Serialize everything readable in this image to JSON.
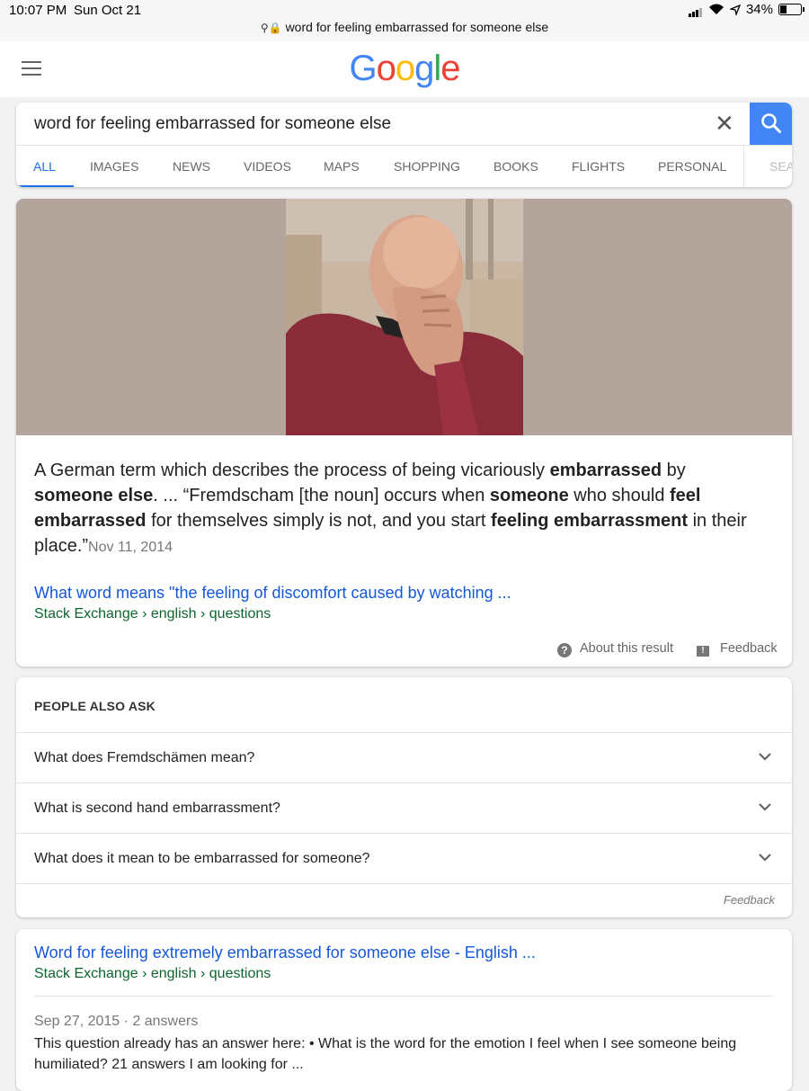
{
  "status_bar": {
    "time": "10:07 PM",
    "date": "Sun Oct 21",
    "url": "word for feeling embarrassed for someone else",
    "battery": "34%",
    "battery_level": 0.34
  },
  "header": {
    "logo_letters": [
      {
        "ch": "G",
        "color": "#4285f4"
      },
      {
        "ch": "o",
        "color": "#ea4335"
      },
      {
        "ch": "o",
        "color": "#fbbc05"
      },
      {
        "ch": "g",
        "color": "#4285f4"
      },
      {
        "ch": "l",
        "color": "#34a853"
      },
      {
        "ch": "e",
        "color": "#ea4335"
      }
    ]
  },
  "search": {
    "query": "word for feeling embarrassed for someone else",
    "clear": "✕"
  },
  "tabs": [
    {
      "label": "ALL",
      "active": true
    },
    {
      "label": "IMAGES"
    },
    {
      "label": "NEWS"
    },
    {
      "label": "VIDEOS"
    },
    {
      "label": "MAPS"
    },
    {
      "label": "SHOPPING"
    },
    {
      "label": "BOOKS"
    },
    {
      "label": "FLIGHTS"
    },
    {
      "label": "PERSONAL"
    },
    {
      "label": "SEA"
    }
  ],
  "featured": {
    "s1": "A German term which describes the process of being vicariously ",
    "b1": "embarrassed",
    "s2": " by ",
    "b2": "someone else",
    "s3": ". ... “Fremdscham [the noun] occurs when ",
    "b3": "someone",
    "s4": " who should ",
    "b4": "feel embarrassed",
    "s5": " for themselves simply is not, and you start ",
    "b5": "feeling embarrassment",
    "s6": " in their place.”",
    "date": "Nov 11, 2014",
    "link": "What word means \"the feeling of discomfort caused by watching ...",
    "breadcrumb": "Stack Exchange › english › questions",
    "about": "About this result",
    "feedback": "Feedback"
  },
  "people_also_ask": {
    "title": "PEOPLE ALSO ASK",
    "questions": [
      "What does Fremdschämen mean?",
      "What is second hand embarrassment?",
      "What does it mean to be embarrassed for someone?"
    ],
    "feedback": "Feedback"
  },
  "result": {
    "title": "Word for feeling extremely embarrassed for someone else - English ...",
    "breadcrumb": "Stack Exchange › english › questions",
    "meta": "Sep 27, 2015 · 2 answers",
    "description": "This question already has an answer here: • What is the word for the emotion I feel when I see someone being humiliated? 21 answers I am looking for ..."
  },
  "colors": {
    "link": "#1558d6",
    "url_green": "#0d652d",
    "accent_blue": "#4285f4",
    "image_bg": "#b3a59c"
  }
}
